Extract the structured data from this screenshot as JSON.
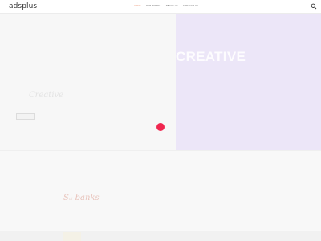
{
  "header": {
    "logo": "adsplus",
    "nav": [
      {
        "label": "HOME",
        "active": true
      },
      {
        "label": "OUR WORKS",
        "active": false
      },
      {
        "label": "ABOUT US",
        "active": false
      },
      {
        "label": "CONTACT US",
        "active": false
      }
    ],
    "search_icon": "search-icon"
  },
  "hero": {
    "headline": "CREATIVE",
    "script_text": "Creative",
    "accent_color": "#f0264f",
    "panel_color": "#ece6f8"
  },
  "signature": {
    "first": "S",
    "middle": "ai",
    "last": "banks"
  },
  "colors": {
    "nav_active": "#e8855f",
    "background": "#f8f8f8"
  }
}
